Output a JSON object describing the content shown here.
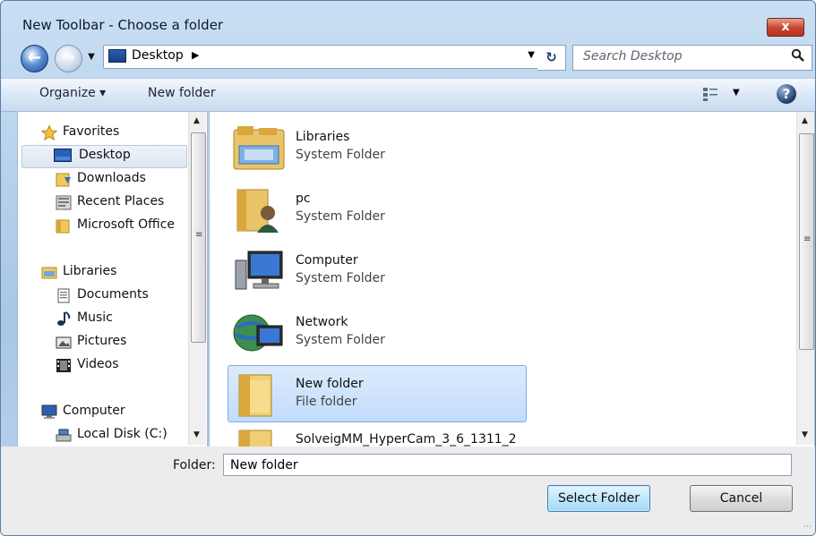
{
  "window": {
    "title": "New Toolbar - Choose a folder",
    "close_label": "x"
  },
  "address_bar": {
    "location": "Desktop",
    "arrow": "▶",
    "dropdown": "▼",
    "refresh": "↻"
  },
  "search": {
    "placeholder": "Search Desktop"
  },
  "toolbar": {
    "organize_label": "Organize ▾",
    "new_folder_label": "New folder",
    "views_dropdown": "▼",
    "help_label": "?"
  },
  "sidebar": {
    "items": [
      {
        "label": "Favorites",
        "icon": "star-icon"
      },
      {
        "label": "Desktop",
        "icon": "desktop-icon",
        "selected": true
      },
      {
        "label": "Downloads",
        "icon": "downloads-icon"
      },
      {
        "label": "Recent Places",
        "icon": "recent-places-icon"
      },
      {
        "label": "Microsoft Office",
        "icon": "folder-icon"
      },
      {
        "label": "Libraries",
        "icon": "libraries-icon"
      },
      {
        "label": "Documents",
        "icon": "documents-icon"
      },
      {
        "label": "Music",
        "icon": "music-icon"
      },
      {
        "label": "Pictures",
        "icon": "pictures-icon"
      },
      {
        "label": "Videos",
        "icon": "videos-icon"
      },
      {
        "label": "Computer",
        "icon": "computer-icon"
      },
      {
        "label": "Local Disk (C:)",
        "icon": "local-disk-icon"
      }
    ]
  },
  "files": [
    {
      "name": "Libraries",
      "type": "System Folder",
      "icon": "libraries-folder-icon"
    },
    {
      "name": "pc",
      "type": "System Folder",
      "icon": "user-folder-icon"
    },
    {
      "name": "Computer",
      "type": "System Folder",
      "icon": "computer-icon"
    },
    {
      "name": "Network",
      "type": "System Folder",
      "icon": "network-icon"
    },
    {
      "name": "New folder",
      "type": "File folder",
      "icon": "folder-icon",
      "selected": true
    },
    {
      "name": "SolveigMM_HyperCam_3_6_1311_2",
      "type": "",
      "icon": "folder-icon"
    }
  ],
  "footer": {
    "folder_label": "Folder:",
    "folder_value": "New folder",
    "select_button": "Select Folder",
    "cancel_button": "Cancel"
  },
  "colors": {
    "window_frame": "#a9c6e6",
    "selection": "#c1dcfc",
    "close_button": "#c7432c"
  }
}
